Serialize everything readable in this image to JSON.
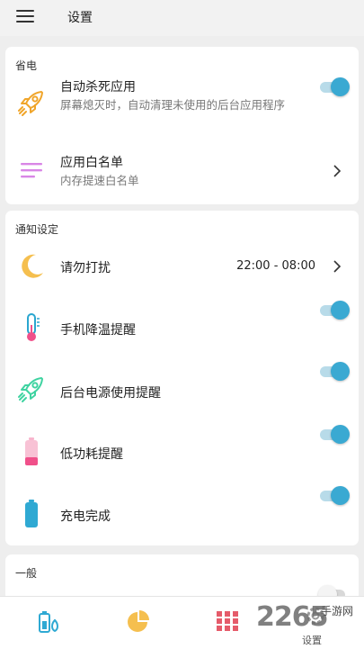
{
  "header": {
    "title": "设置"
  },
  "sections": {
    "power": {
      "title": "省电",
      "auto_kill": {
        "label": "自动杀死应用",
        "desc": "屏幕熄灭时，自动清理未使用的后台应用程序",
        "enabled": true,
        "icon": "rocket-icon"
      },
      "whitelist": {
        "label": "应用白名单",
        "desc": "内存提速白名单",
        "icon": "list-icon"
      }
    },
    "notify": {
      "title": "通知设定",
      "dnd": {
        "label": "请勿打扰",
        "value": "22:00 - 08:00",
        "icon": "moon-icon"
      },
      "temp": {
        "label": "手机降温提醒",
        "enabled": true,
        "icon": "thermometer-icon"
      },
      "bg_power": {
        "label": "后台电源使用提醒",
        "enabled": true,
        "icon": "rocket-icon"
      },
      "low_power": {
        "label": "低功耗提醒",
        "enabled": true,
        "icon": "battery-low-icon"
      },
      "charge_done": {
        "label": "充电完成",
        "enabled": true,
        "icon": "battery-full-icon"
      }
    },
    "general": {
      "title": "一般",
      "partial_toggle_enabled": false
    }
  },
  "bottom_nav": {
    "items": [
      {
        "icon": "battery-saver-icon"
      },
      {
        "icon": "pie-chart-icon"
      },
      {
        "icon": "apps-grid-icon"
      },
      {
        "icon": "gear-icon",
        "label": "设置"
      }
    ]
  },
  "watermark": {
    "text": "2265",
    "subtext": "手游网"
  },
  "colors": {
    "accent": "#3aa9d2",
    "rocket": "#f0a52a",
    "rocket_green": "#3fd3a1",
    "list": "#d986e6",
    "moon": "#f5bf4f",
    "battery_low": "#f0508a",
    "battery_full": "#2fa9d3"
  }
}
